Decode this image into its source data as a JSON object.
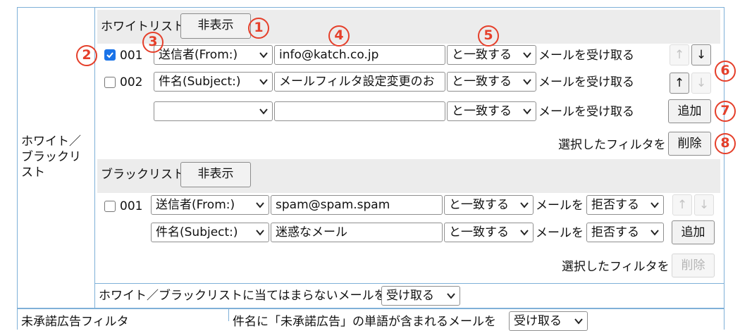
{
  "row_label": "ホワイト／ブラックリスト",
  "whitelist": {
    "title": "ホワイトリスト",
    "toggle_label": "非表示",
    "rows": [
      {
        "number": "001",
        "checked": true,
        "field": "送信者(From:)",
        "value": "info@katch.co.jp",
        "match": "と一致する",
        "action_text": "メールを受け取る"
      },
      {
        "number": "002",
        "checked": false,
        "field": "件名(Subject:)",
        "value": "メールフィルタ設定変更のお",
        "match": "と一致する",
        "action_text": "メールを受け取る"
      }
    ],
    "new_row": {
      "field": "",
      "value": "",
      "match": "と一致する",
      "action_text": "メールを受け取る"
    },
    "add_label": "追加",
    "selected_text": "選択したフィルタを",
    "delete_label": "削除",
    "up_arrow": "↑",
    "down_arrow": "↓"
  },
  "blacklist": {
    "title": "ブラックリスト",
    "toggle_label": "非表示",
    "rows": [
      {
        "number": "001",
        "checked": false,
        "field": "送信者(From:)",
        "value": "spam@spam.spam",
        "match": "と一致する",
        "action_prefix": "メールを",
        "action": "拒否する"
      }
    ],
    "new_row": {
      "field": "件名(Subject:)",
      "value": "迷惑なメール",
      "match": "と一致する",
      "action_prefix": "メールを",
      "action": "拒否する"
    },
    "add_label": "追加",
    "selected_text": "選択したフィルタを",
    "delete_label": "削除",
    "up_arrow": "↑",
    "down_arrow": "↓"
  },
  "fallback": {
    "text": "ホワイト／ブラックリストに当てはまらないメールを",
    "action": "受け取る"
  },
  "next_row": {
    "label": "未承諾広告フィルタ",
    "text": "件名に「未承諾広告」の単語が含まれるメールを",
    "action": "受け取る"
  },
  "callouts": [
    "1",
    "2",
    "3",
    "4",
    "5",
    "6",
    "7",
    "8"
  ],
  "colors": {
    "callout": "#e53f2a",
    "border": "#7fb0d8",
    "section_bg": "#ececec",
    "checkbox": "#1a73e8"
  }
}
